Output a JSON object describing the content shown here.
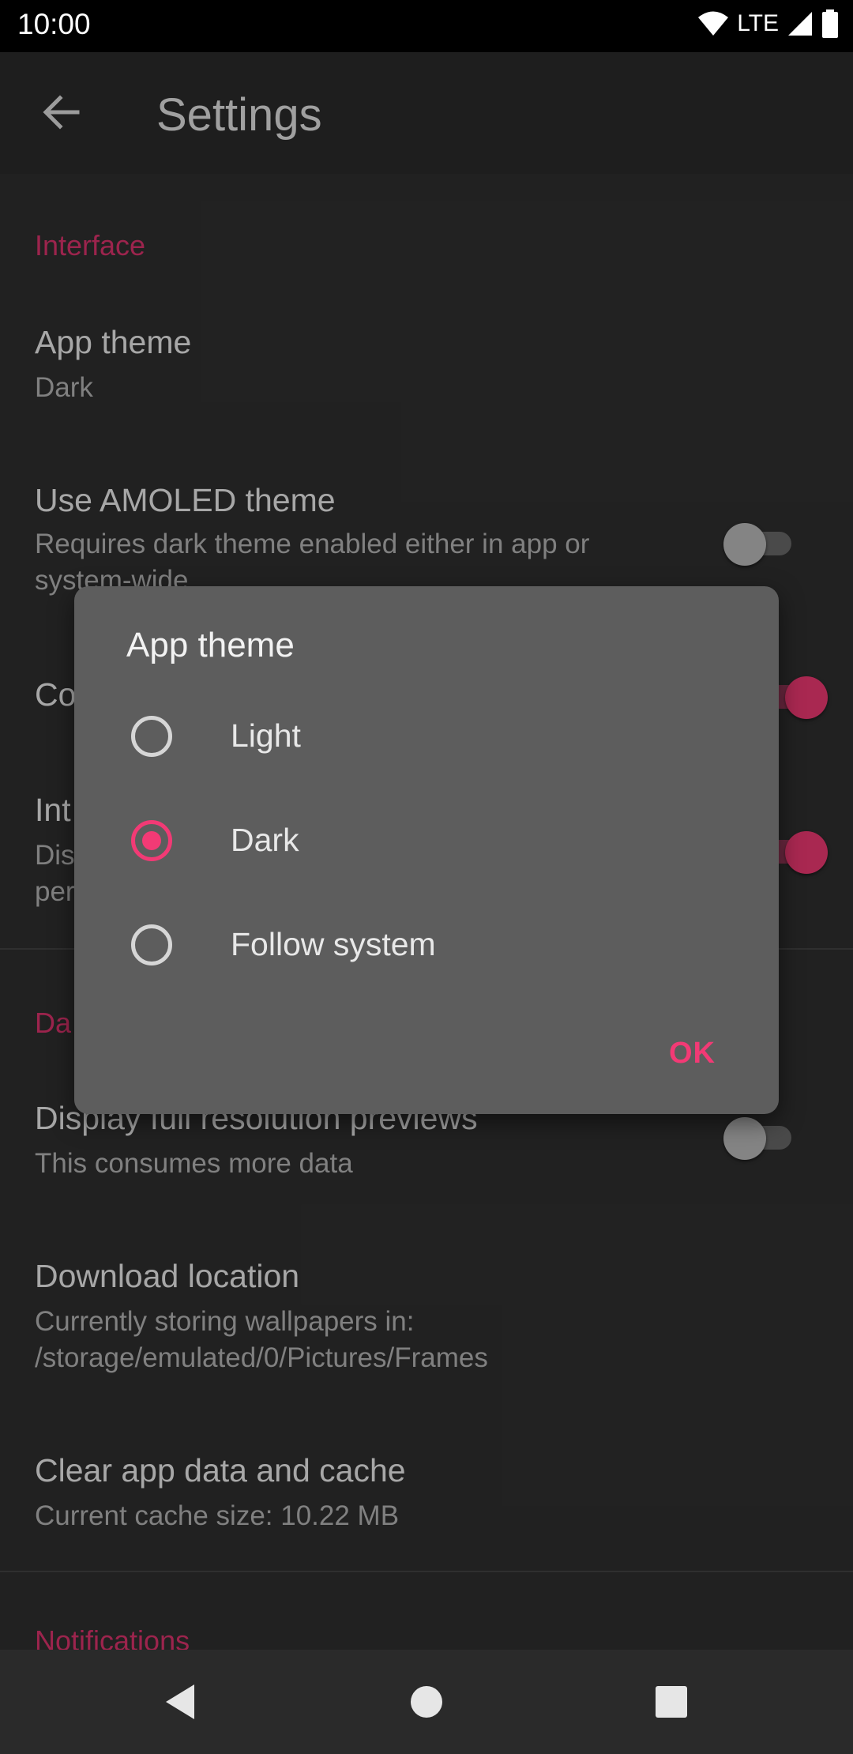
{
  "status_bar": {
    "time": "10:00",
    "network": "LTE"
  },
  "app_bar": {
    "title": "Settings"
  },
  "sections": {
    "interface": {
      "header": "Interface",
      "app_theme": {
        "title": "App theme",
        "summary": "Dark"
      },
      "amoled": {
        "title": "Use AMOLED theme",
        "summary": "Requires dark theme enabled either in app or system-wide",
        "enabled": false
      },
      "partial_row_1": {
        "title": "Co"
      },
      "partial_row_2": {
        "title": "Int",
        "summary_line1": "Dis",
        "summary_line2": "per"
      }
    },
    "data": {
      "header_partial": "Da",
      "full_res": {
        "title": "Display full resolution previews",
        "summary": "This consumes more data",
        "enabled": false
      },
      "download_location": {
        "title": "Download location",
        "summary_line1": "Currently storing wallpapers in:",
        "summary_line2": "/storage/emulated/0/Pictures/Frames"
      },
      "clear_data": {
        "title": "Clear app data and cache",
        "summary": "Current cache size: 10.22 MB"
      }
    },
    "notifications": {
      "header": "Notifications"
    }
  },
  "dialog": {
    "title": "App theme",
    "options": [
      {
        "label": "Light",
        "selected": false
      },
      {
        "label": "Dark",
        "selected": true
      },
      {
        "label": "Follow system",
        "selected": false
      }
    ],
    "ok_label": "OK"
  },
  "colors": {
    "accent": "#f23a75",
    "background": "#303030",
    "dialog": "#5d5d5d"
  }
}
